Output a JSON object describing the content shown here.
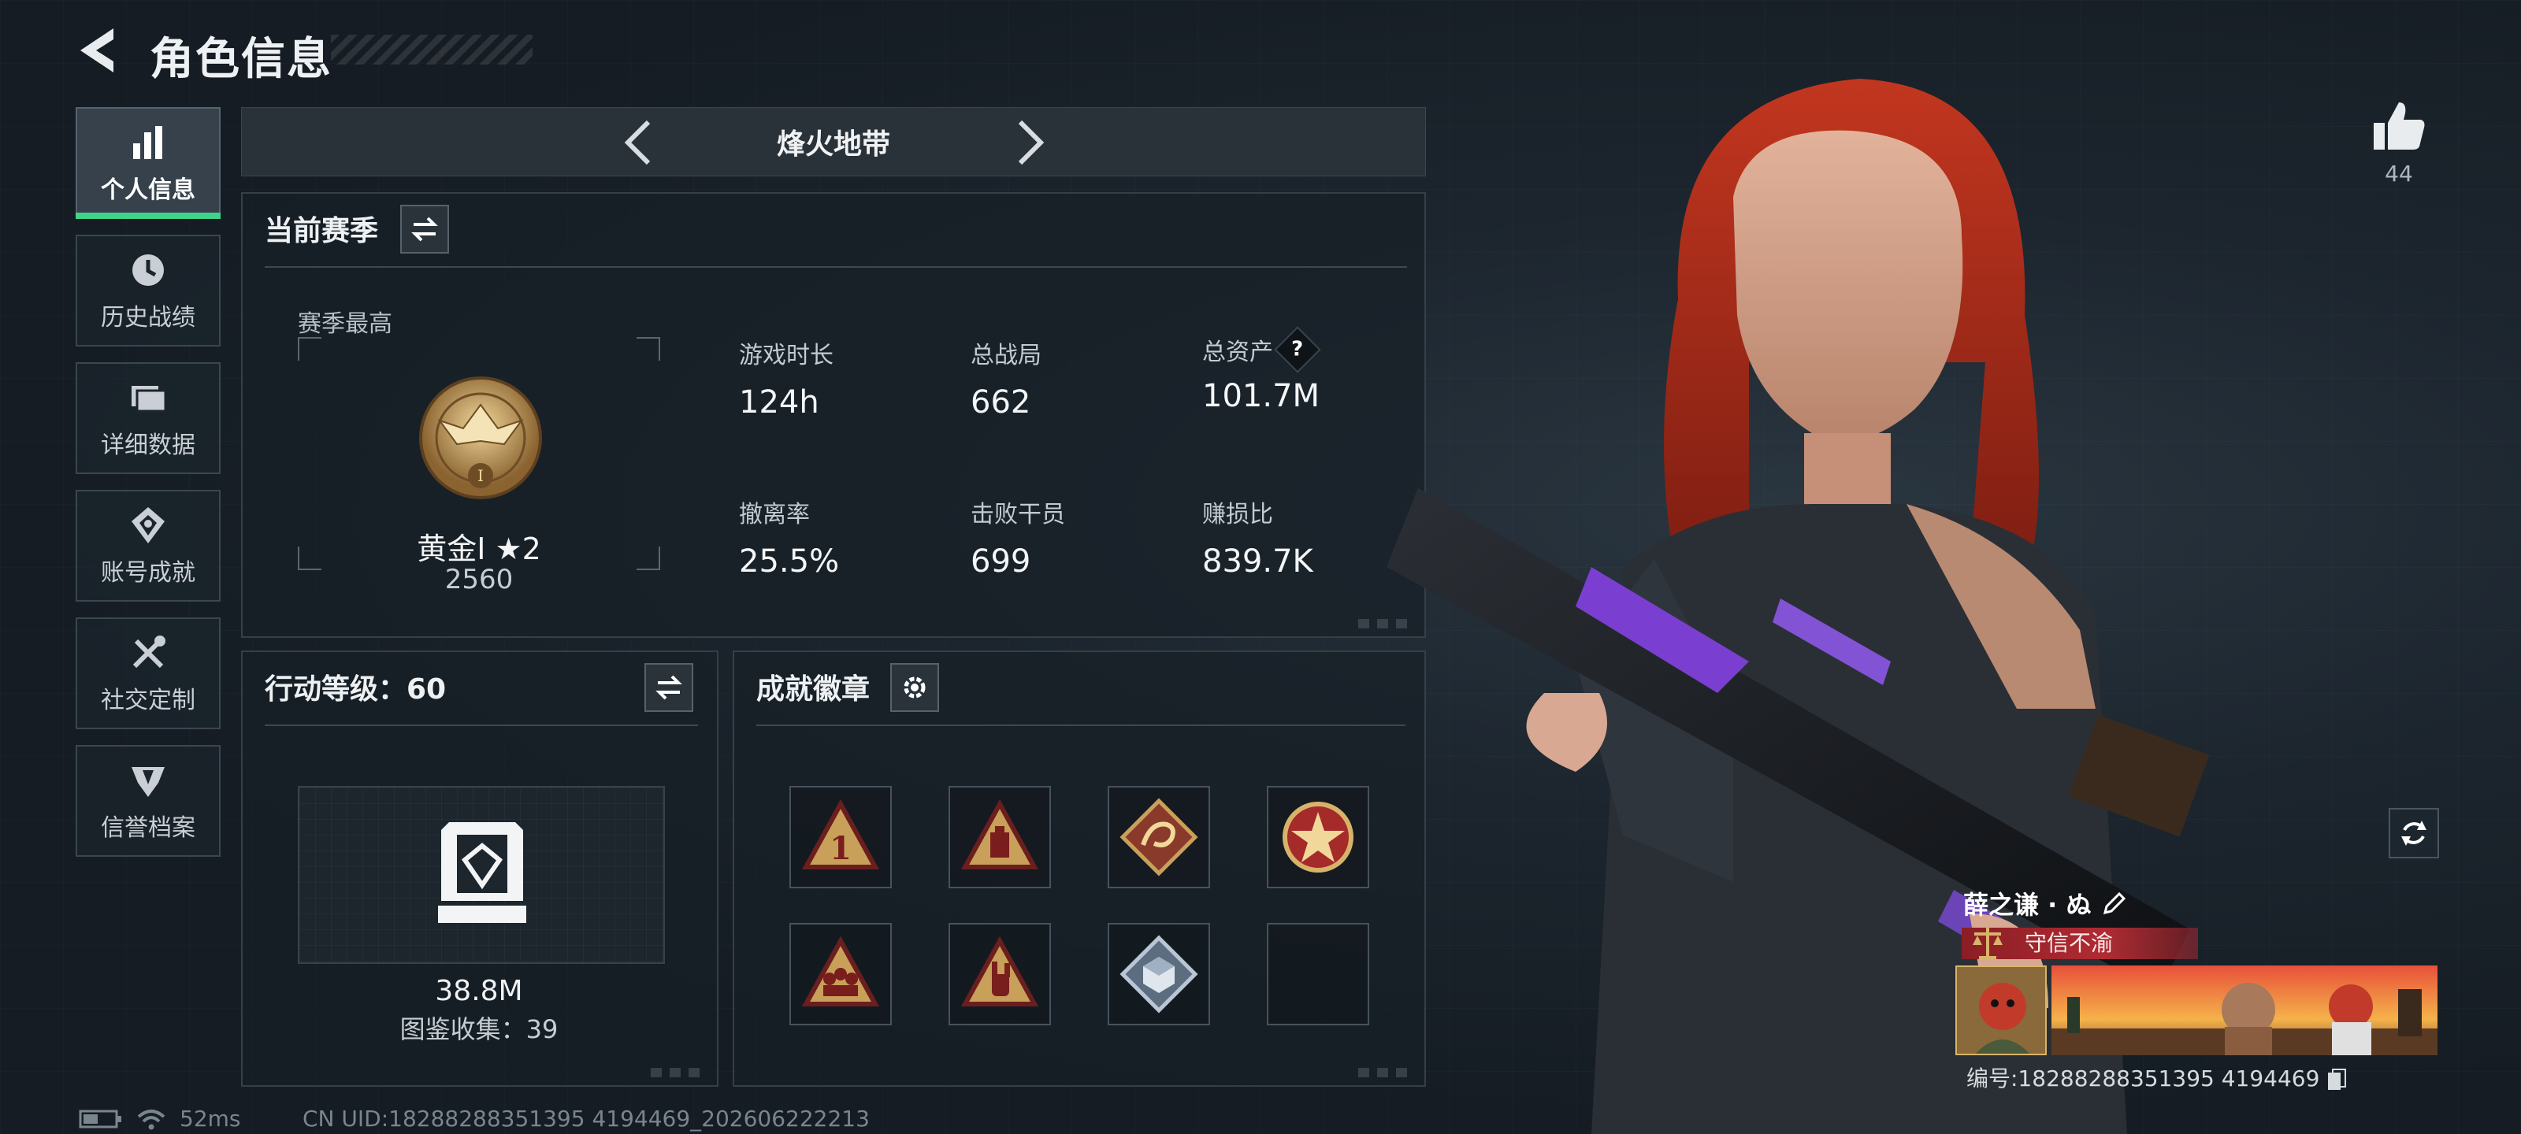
{
  "header": {
    "title": "角色信息"
  },
  "sidebar": {
    "items": [
      {
        "label": "个人信息",
        "icon": "bar-chart-icon",
        "active": true
      },
      {
        "label": "历史战绩",
        "icon": "clock-icon"
      },
      {
        "label": "详细数据",
        "icon": "folder-icon"
      },
      {
        "label": "账号成就",
        "icon": "achievement-icon"
      },
      {
        "label": "社交定制",
        "icon": "tools-icon"
      },
      {
        "label": "信誉档案",
        "icon": "shield-icon"
      }
    ]
  },
  "mode": {
    "title": "烽火地带"
  },
  "season": {
    "heading": "当前赛季",
    "best_label": "赛季最高",
    "rank_name": "黄金I ★2",
    "rank_score": "2560",
    "stats": [
      {
        "label": "游戏时长",
        "value": "124h"
      },
      {
        "label": "总战局",
        "value": "662"
      },
      {
        "label": "总资产",
        "value": "101.7M",
        "help": "?"
      },
      {
        "label": "撤离率",
        "value": "25.5%"
      },
      {
        "label": "击败干员",
        "value": "699"
      },
      {
        "label": "赚损比",
        "value": "839.7K"
      }
    ]
  },
  "level": {
    "heading": "行动等级：60",
    "value": "38.8M",
    "collection": "图鉴收集：39"
  },
  "achievements": {
    "heading": "成就徽章",
    "badges": [
      "rank-one-badge",
      "supply-badge",
      "dragon-badge",
      "star-emblem-badge",
      "team-badge",
      "hand-sign-badge",
      "crate-badge",
      "empty-badge-slot"
    ]
  },
  "status": {
    "ping": "52ms",
    "uid": "CN UID:18288288351395 4194469_202606222213"
  },
  "profile": {
    "likes": "44",
    "name": "薛之谦 · ぬ",
    "motto": "守信不渝",
    "player_id": "编号:18288288351395 4194469"
  },
  "colors": {
    "accent": "#3fd48a",
    "motto_red": "#b02b33",
    "gold": "#c8a05a"
  }
}
